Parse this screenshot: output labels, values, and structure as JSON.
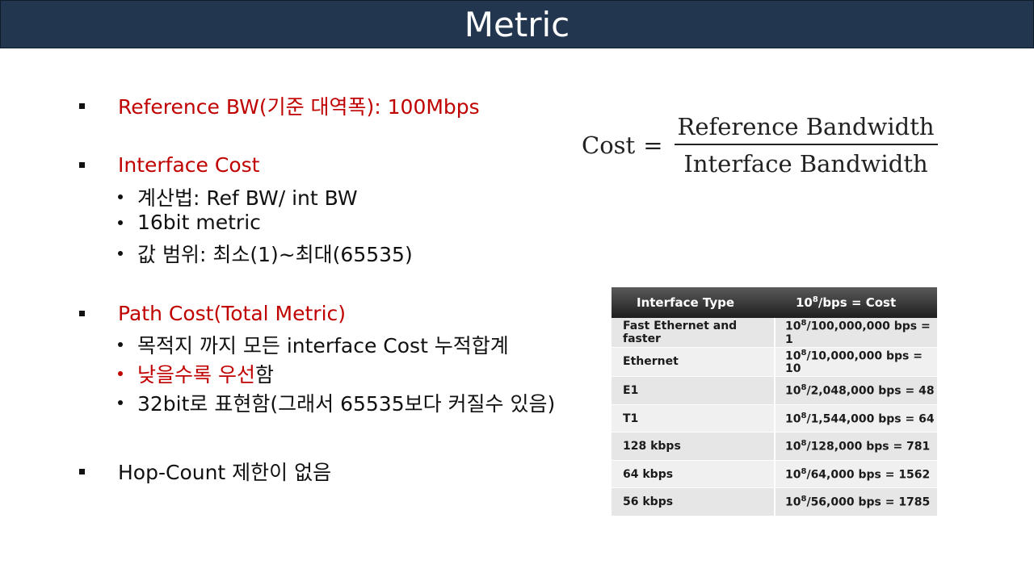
{
  "title": "Metric",
  "bullets": {
    "reference_bw": "Reference BW(기준 대역폭): 100Mbps",
    "interface_cost": {
      "heading": "Interface Cost",
      "items": [
        "계산법: Ref BW/ int BW",
        "16bit metric",
        "값 범위: 최소(1)~최대(65535)"
      ]
    },
    "path_cost": {
      "heading": "Path Cost(Total Metric)",
      "item1": "목적지 까지 모든 interface Cost 누적합계",
      "item2_red": "낮을수록 우선",
      "item2_rest": "함",
      "item3": "32bit로 표현함(그래서 65535보다 커질수 있음)"
    },
    "hop_count": "Hop-Count 제한이 없음"
  },
  "formula": {
    "lhs": "Cost",
    "eq": "=",
    "numerator": "Reference Bandwidth",
    "denominator": "Interface Bandwidth"
  },
  "table": {
    "header": {
      "col1": "Interface Type",
      "col2_base": "10",
      "col2_exp": "8",
      "col2_rest": "/bps = Cost"
    },
    "rows": [
      {
        "type": "Fast Ethernet and faster",
        "base": "10",
        "exp": "8",
        "rest": "/100,000,000 bps = 1"
      },
      {
        "type": "Ethernet",
        "base": "10",
        "exp": "8",
        "rest": "/10,000,000 bps = 10"
      },
      {
        "type": "E1",
        "base": "10",
        "exp": "8",
        "rest": "/2,048,000 bps = 48"
      },
      {
        "type": "T1",
        "base": "10",
        "exp": "8",
        "rest": "/1,544,000 bps = 64"
      },
      {
        "type": "128 kbps",
        "base": "10",
        "exp": "8",
        "rest": "/128,000 bps = 781"
      },
      {
        "type": "64 kbps",
        "base": "10",
        "exp": "8",
        "rest": "/64,000 bps = 1562"
      },
      {
        "type": "56 kbps",
        "base": "10",
        "exp": "8",
        "rest": "/56,000 bps = 1785"
      }
    ]
  },
  "colors": {
    "title_bar": "#22374f",
    "accent_red": "#c00000"
  }
}
